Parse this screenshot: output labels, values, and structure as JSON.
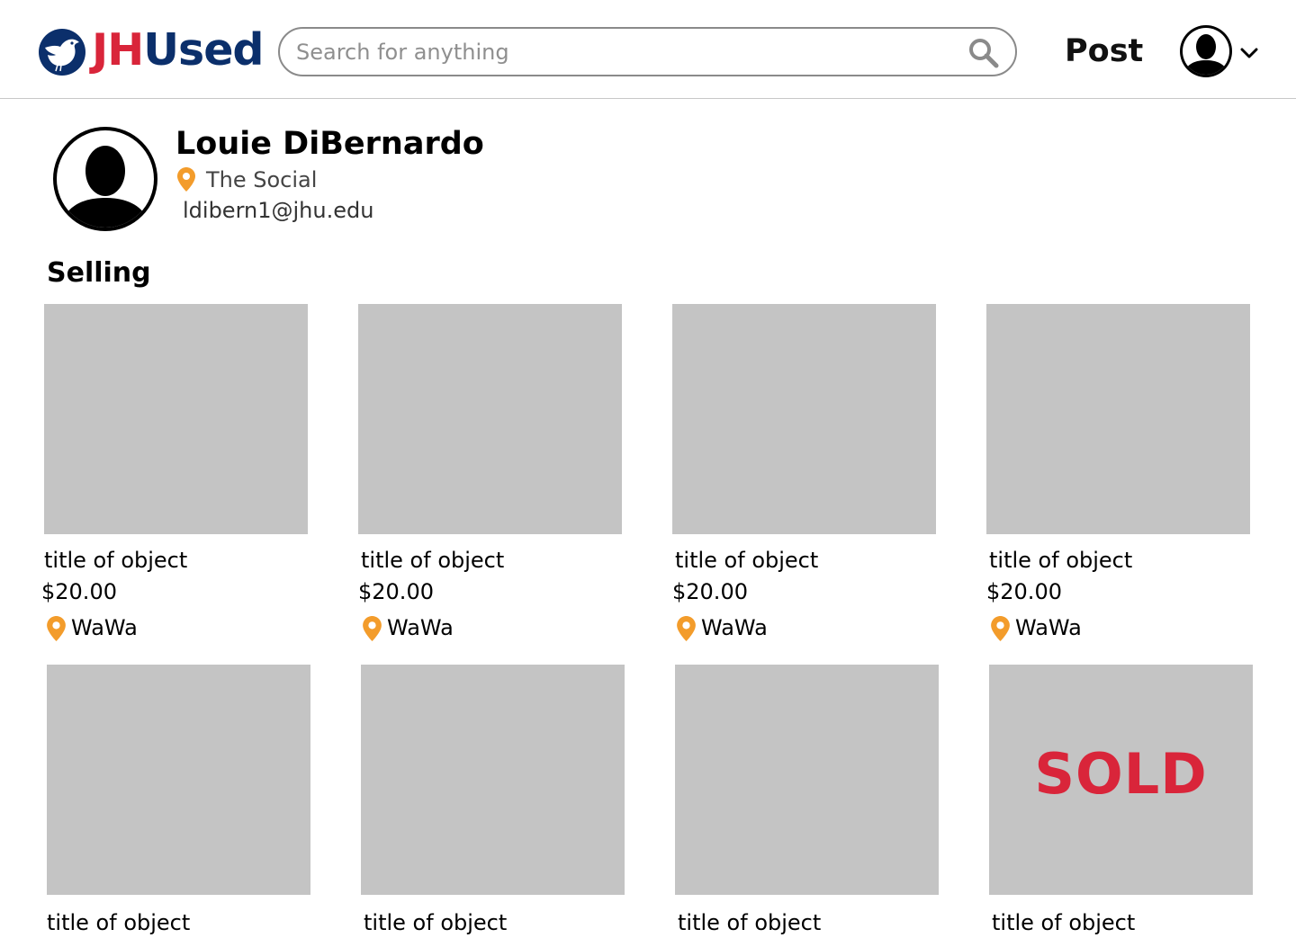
{
  "header": {
    "logo_jh": "JH",
    "logo_used": "Used",
    "search_placeholder": "Search for anything",
    "post_label": "Post",
    "brand_red": "#d9253a",
    "brand_blue": "#0b2f6b"
  },
  "profile": {
    "name": "Louie DiBernardo",
    "location": "The Social",
    "email": "ldibern1@jhu.edu"
  },
  "section": {
    "title": "Selling"
  },
  "listings": [
    {
      "title": "title of object",
      "price": "$20.00",
      "location": "WaWa",
      "sold": false
    },
    {
      "title": "title of object",
      "price": "$20.00",
      "location": "WaWa",
      "sold": false
    },
    {
      "title": "title of object",
      "price": "$20.00",
      "location": "WaWa",
      "sold": false
    },
    {
      "title": "title of object",
      "price": "$20.00",
      "location": "WaWa",
      "sold": false
    },
    {
      "title": "title of object",
      "price": "",
      "location": "",
      "sold": false
    },
    {
      "title": "title of object",
      "price": "",
      "location": "",
      "sold": false
    },
    {
      "title": "title of object",
      "price": "",
      "location": "",
      "sold": false
    },
    {
      "title": "title of object",
      "price": "",
      "location": "",
      "sold": true,
      "sold_label": "SOLD"
    }
  ],
  "colors": {
    "pin": "#f39c2b",
    "placeholder_image": "#c4c4c4",
    "sold": "#d9253a"
  }
}
